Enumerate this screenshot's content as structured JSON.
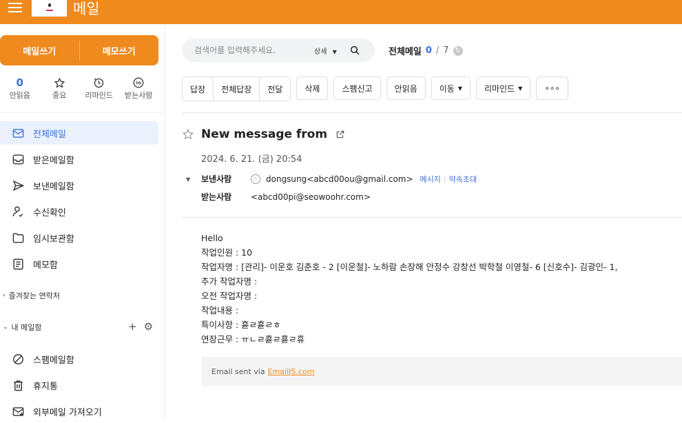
{
  "app": {
    "title": "메일"
  },
  "compose": {
    "write_mail": "메일쓰기",
    "write_memo": "메모쓰기"
  },
  "quick_actions": [
    {
      "label": "안읽음",
      "value": "0",
      "icon": "unread-count"
    },
    {
      "label": "중요",
      "icon": "star-icon"
    },
    {
      "label": "리마인드",
      "icon": "clock-icon"
    },
    {
      "label": "받는사람",
      "icon": "to-icon",
      "icon_text": "TO"
    }
  ],
  "nav": [
    {
      "label": "전체메일",
      "icon": "mail-icon",
      "active": true
    },
    {
      "label": "받은메일함",
      "icon": "inbox-icon"
    },
    {
      "label": "보낸메일함",
      "icon": "send-icon"
    },
    {
      "label": "수신확인",
      "icon": "person-check-icon"
    },
    {
      "label": "임시보관함",
      "icon": "folder-icon"
    },
    {
      "label": "메모함",
      "icon": "memo-icon"
    }
  ],
  "sections": {
    "favorites": "즐겨찾는 연락처",
    "my_mailbox": "내 메일함"
  },
  "nav2": [
    {
      "label": "스팸메일함",
      "icon": "block-icon"
    },
    {
      "label": "휴지통",
      "icon": "trash-icon"
    },
    {
      "label": "외부메일 가져오기",
      "icon": "import-mail-icon"
    }
  ],
  "search": {
    "placeholder": "검색어를 입력해주세요.",
    "detail": "상세"
  },
  "counter": {
    "label": "전체메일",
    "unread": "0",
    "sep": "/",
    "total": "7"
  },
  "toolbar": {
    "reply": "답장",
    "reply_all": "전체답장",
    "forward": "전달",
    "delete": "삭제",
    "spam": "스팸신고",
    "unread": "안읽음",
    "move": "이동",
    "remind": "리마인드",
    "more": "∘∘∘"
  },
  "message": {
    "subject": "New message from",
    "date": "2024. 6. 21. (금) 20:54",
    "from_label": "보낸사람",
    "from": "dongsung<abcd00ou@gmail.com>",
    "from_action_message": "메시지",
    "from_action_invite": "약속초대",
    "to_label": "받는사람",
    "to": "<abcd00pi@seowoohr.com>",
    "body_lines": [
      "Hello",
      "작업인원 : 10",
      "작업자명 : [관리]- 이운호 김춘호 - 2 [이운철]- 노하람 손장해 안정수 강창선 박학철 이영철- 6 [신호수]- 김광인- 1,",
      "추가 작업자명 :",
      "오전 작업자명 :",
      "작업내용 :",
      "특이사항 : 휻ㄹ휻ㄹㅎ",
      "연장근무 : ㅠㄴㄹ휻ㄹ휻ㄹ휴"
    ],
    "footer_text": "Email sent via",
    "footer_link": "EmailJS.com"
  },
  "colors": {
    "brand": "#f08a1c",
    "accent": "#3a6fd8"
  }
}
